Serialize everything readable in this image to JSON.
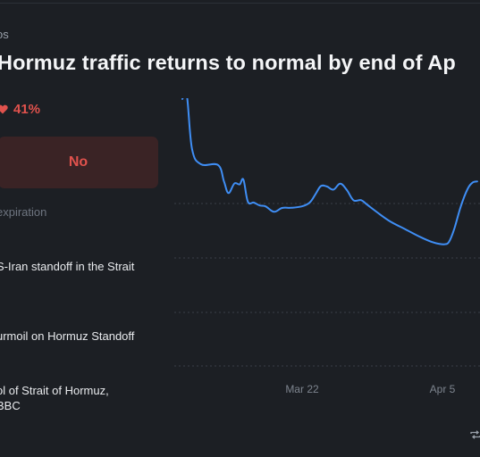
{
  "market": {
    "category_fragment": "os",
    "title": "Hormuz traffic returns to normal by end of Ap",
    "probability_label": "41%",
    "outcome_button_label": "No",
    "expiration_label": "expiration"
  },
  "news": [
    {
      "lines": [
        "S-Iran standoff in the Strait"
      ]
    },
    {
      "lines": [
        "urmoil on Hormuz Standoff"
      ]
    },
    {
      "lines": [
        "ol of Strait of Hormuz,",
        "BBC"
      ]
    }
  ],
  "icons": {
    "probability_icon": "heart-icon",
    "footer_icon": "repeat-icon"
  },
  "colors": {
    "background": "#1c1f24",
    "line": "#3f8ef5",
    "negative": "#e0524d",
    "button_bg": "#3a2325"
  },
  "chart_data": {
    "type": "line",
    "x_tick_labels": [
      "Mar 22",
      "Apr 5"
    ],
    "faint_y_tick_label": "",
    "series": [
      {
        "values": [
          [
            0,
            54
          ],
          [
            0.6,
            56
          ],
          [
            1.3,
            28
          ],
          [
            2.5,
            20
          ],
          [
            4.8,
            19.6
          ],
          [
            5.6,
            11
          ],
          [
            6.2,
            5
          ],
          [
            7,
            10
          ],
          [
            7.7,
            9.5
          ],
          [
            8.2,
            12
          ],
          [
            8.8,
            0.5
          ],
          [
            9.6,
            0
          ],
          [
            10.4,
            -1.5
          ],
          [
            11.2,
            -2
          ],
          [
            12.3,
            -4.8
          ],
          [
            13.4,
            -2.8
          ],
          [
            14.6,
            -2.7
          ],
          [
            16,
            -2
          ],
          [
            17.1,
            0
          ],
          [
            17.9,
            4.5
          ],
          [
            18.6,
            8.6
          ],
          [
            19.4,
            8.4
          ],
          [
            20.3,
            6.8
          ],
          [
            21.2,
            9.9
          ],
          [
            22.1,
            6.5
          ],
          [
            23,
            1.2
          ],
          [
            24,
            1.3
          ],
          [
            24.8,
            -1
          ],
          [
            26.5,
            -6
          ],
          [
            28,
            -10
          ],
          [
            30,
            -14
          ],
          [
            32,
            -18
          ],
          [
            33.5,
            -20.5
          ],
          [
            34.5,
            -21.5
          ],
          [
            35.2,
            -21.7
          ],
          [
            35.8,
            -20.5
          ],
          [
            36.5,
            -14
          ],
          [
            37.4,
            -2
          ],
          [
            38.3,
            7
          ],
          [
            39,
            10.5
          ],
          [
            39.6,
            11
          ]
        ]
      }
    ],
    "grid": true,
    "axes_visible": false
  }
}
